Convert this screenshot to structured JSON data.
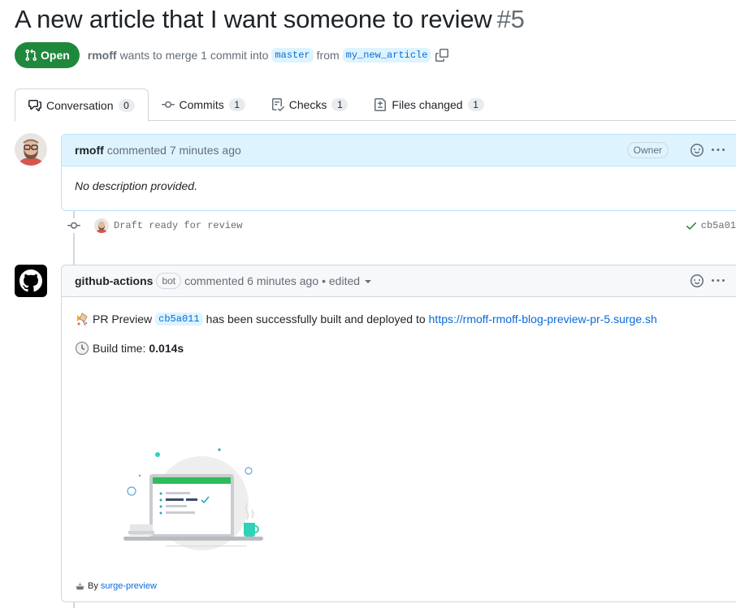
{
  "pr": {
    "title": "A new article that I want someone to review",
    "number": "#5",
    "state": "Open",
    "author": "rmoff",
    "merge_text": "wants to merge 1 commit into",
    "base_branch": "master",
    "from_text": "from",
    "head_branch": "my_new_article"
  },
  "tabs": [
    {
      "label": "Conversation",
      "count": "0",
      "icon": "comment-discussion-icon"
    },
    {
      "label": "Commits",
      "count": "1",
      "icon": "git-commit-icon"
    },
    {
      "label": "Checks",
      "count": "1",
      "icon": "checklist-icon"
    },
    {
      "label": "Files changed",
      "count": "1",
      "icon": "file-diff-icon"
    }
  ],
  "comment1": {
    "author": "rmoff",
    "action": "commented 7 minutes ago",
    "role": "Owner",
    "body": "No description provided."
  },
  "commit": {
    "message": "Draft ready for review",
    "sha": "cb5a01"
  },
  "comment2": {
    "author": "github-actions",
    "badge": "bot",
    "action": "commented 6 minutes ago",
    "edited": "• edited",
    "preview_label": "PR Preview",
    "preview_sha": "cb5a011",
    "deployed_text": "has been successfully built and deployed to",
    "url": "https://rmoff-rmoff-blog-preview-pr-5.surge.sh",
    "build_label": "Build time:",
    "build_time": "0.014s",
    "footer_by": "By",
    "footer_link": "surge-preview"
  },
  "colors": {
    "open_green": "#1f883d",
    "link_blue": "#0969da",
    "header_blue": "#ddf4ff"
  }
}
